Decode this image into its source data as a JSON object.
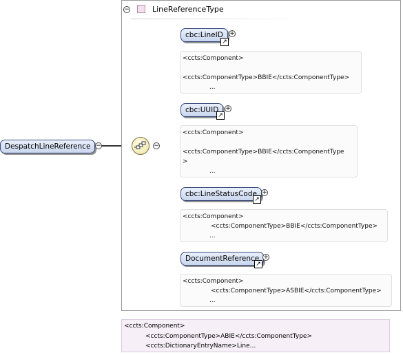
{
  "root": {
    "label": "DespatchLineReference"
  },
  "type": {
    "label": "LineReferenceType",
    "collapse_glyph": "⊖"
  },
  "children": [
    {
      "label": "cbc:LineID",
      "ann": [
        "<ccts:Component>",
        "<ccts:ComponentType>BBIE</ccts:ComponentType>",
        "..."
      ]
    },
    {
      "label": "cbc:UUID",
      "ann": [
        "<ccts:Component>",
        "<ccts:ComponentType>BBIE</ccts:ComponentType",
        ">",
        "..."
      ]
    },
    {
      "label": "cbc:LineStatusCode",
      "ann": [
        "<ccts:Component>",
        "<ccts:ComponentType>BBIE</ccts:ComponentType>",
        "..."
      ]
    },
    {
      "label": "DocumentReference",
      "ann": [
        "<ccts:Component>",
        "<ccts:ComponentType>ASBIE</ccts:ComponentType>",
        "..."
      ]
    }
  ],
  "type_annotation": [
    "<ccts:Component>",
    "<ccts:ComponentType>ABIE</ccts:ComponentType>",
    "<ccts:DictionaryEntryName>Line..."
  ],
  "glyphs": {
    "plus": "+",
    "minus": "−",
    "link": "↗"
  }
}
